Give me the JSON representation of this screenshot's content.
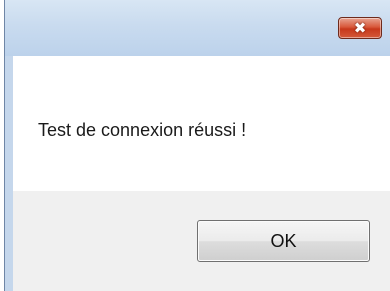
{
  "dialog": {
    "close_icon": "close-icon",
    "close_glyph": "✖",
    "message": "Test de connexion réussi !",
    "ok_label": "OK"
  },
  "colors": {
    "titlebar": "#c9dbef",
    "close_button": "#d8583a",
    "content_background": "#ffffff",
    "footer_background": "#f0f0f0"
  }
}
